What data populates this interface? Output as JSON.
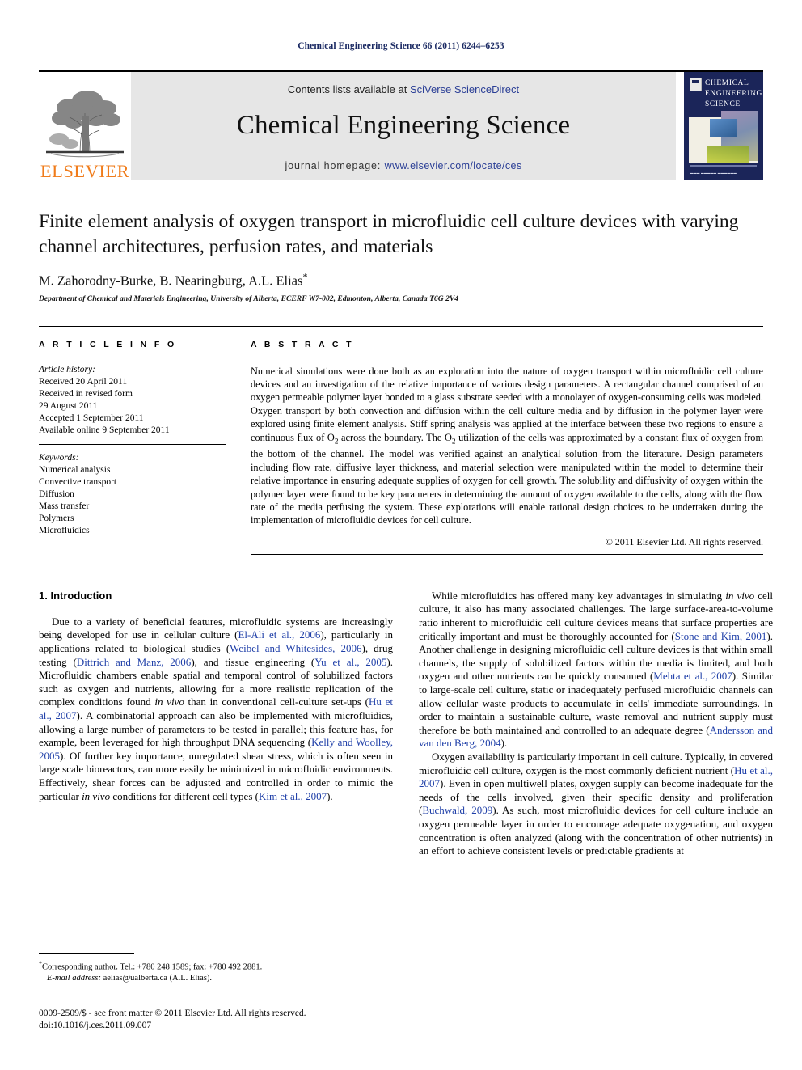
{
  "running_head": "Chemical Engineering Science 66 (2011) 6244–6253",
  "masthead": {
    "publisher_wordmark": "ELSEVIER",
    "contents_prefix": "Contents lists available at ",
    "sciencedirect_link": "SciVerse ScienceDirect",
    "journal_title": "Chemical Engineering Science",
    "homepage_prefix": "journal homepage: ",
    "homepage_link": "www.elsevier.com/locate/ces",
    "cover_title": "CHEMICAL ENGINEERING SCIENCE"
  },
  "article": {
    "title": "Finite element analysis of oxygen transport in microfluidic cell culture devices with varying channel architectures, perfusion rates, and materials",
    "authors": "M. Zahorodny-Burke, B. Nearingburg, A.L. Elias",
    "corresponding_marker": "*",
    "affiliation": "Department of Chemical and Materials Engineering, University of Alberta, ECERF W7-002, Edmonton, Alberta, Canada T6G 2V4"
  },
  "info": {
    "heading": "A R T I C L E   I N F O",
    "history_label": "Article history:",
    "history": [
      "Received 20 April 2011",
      "Received in revised form",
      "29 August 2011",
      "Accepted 1 September 2011",
      "Available online 9 September 2011"
    ],
    "keywords_label": "Keywords:",
    "keywords": [
      "Numerical analysis",
      "Convective transport",
      "Diffusion",
      "Mass transfer",
      "Polymers",
      "Microfluidics"
    ]
  },
  "abstract": {
    "heading": "A B S T R A C T",
    "part1": "Numerical simulations were done both as an exploration into the nature of oxygen transport within microfluidic cell culture devices and an investigation of the relative importance of various design parameters. A rectangular channel comprised of an oxygen permeable polymer layer bonded to a glass substrate seeded with a monolayer of oxygen-consuming cells was modeled. Oxygen transport by both convection and diffusion within the cell culture media and by diffusion in the polymer layer were explored using finite element analysis. Stiff spring analysis was applied at the interface between these two regions to ensure a continuous flux of O",
    "sub1": "2",
    "part2": " across the boundary. The O",
    "sub2": "2",
    "part3": " utilization of the cells was approximated by a constant flux of oxygen from the bottom of the channel. The model was verified against an analytical solution from the literature. Design parameters including flow rate, diffusive layer thickness, and material selection were manipulated within the model to determine their relative importance in ensuring adequate supplies of oxygen for cell growth. The solubility and diffusivity of oxygen within the polymer layer were found to be key parameters in determining the amount of oxygen available to the cells, along with the flow rate of the media perfusing the system. These explorations will enable rational design choices to be undertaken during the implementation of microfluidic devices for cell culture.",
    "copyright": "© 2011 Elsevier Ltd. All rights reserved."
  },
  "introduction": {
    "heading": "1. Introduction",
    "left_p1_a": "Due to a variety of beneficial features, microfluidic systems are increasingly being developed for use in cellular culture (",
    "cite_elali": "El-Ali et al., 2006",
    "left_p1_b": "), particularly in applications related to biological studies (",
    "cite_weibel": "Weibel and Whitesides, 2006",
    "left_p1_c": "), drug testing (",
    "cite_dittrich": "Dittrich and Manz, 2006",
    "left_p1_d": "), and tissue engineering (",
    "cite_yu": "Yu et al., 2005",
    "left_p1_e": "). Microfluidic chambers enable spatial and temporal control of solubilized factors such as oxygen and nutrients, allowing for a more realistic replication of the complex conditions found ",
    "left_p1_italic1": "in vivo",
    "left_p1_f": " than in conventional cell-culture set-ups (",
    "cite_hu1": "Hu et al., 2007",
    "left_p1_g": "). A combinatorial approach can also be implemented with microfluidics, allowing a large number of parameters to be tested in parallel; this feature has, for example, been leveraged for high throughput DNA sequencing (",
    "cite_kelly": "Kelly and Woolley, 2005",
    "left_p1_h": "). Of further key importance, unregulated shear stress, which is often seen in large scale bioreactors, can more easily be minimized in microfluidic environments. Effectively, shear forces can be adjusted and controlled in order to mimic the particular ",
    "left_p1_italic2": "in vivo",
    "left_p1_i": " conditions for different cell types (",
    "cite_kim": "Kim et al., 2007",
    "left_p1_j": ").",
    "right_p1_a": "While microfluidics has offered many key advantages in simulating ",
    "right_p1_italic1": "in vivo",
    "right_p1_b": " cell culture, it also has many associated challenges. The large surface-area-to-volume ratio inherent to microfluidic cell culture devices means that surface properties are critically important and must be thoroughly accounted for (",
    "cite_stone": "Stone and Kim, 2001",
    "right_p1_c": "). Another challenge in designing microfluidic cell culture devices is that within small channels, the supply of solubilized factors within the media is limited, and both oxygen and other nutrients can be quickly consumed (",
    "cite_mehta": "Mehta et al., 2007",
    "right_p1_d": "). Similar to large-scale cell culture, static or inadequately perfused microfluidic channels can allow cellular waste products to accumulate in cells' immediate surroundings. In order to maintain a sustainable culture, waste removal and nutrient supply must therefore be both maintained and controlled to an adequate degree (",
    "cite_andersson": "Andersson and van den Berg, 2004",
    "right_p1_e": ").",
    "right_p2_a": "Oxygen availability is particularly important in cell culture. Typically, in covered microfluidic cell culture, oxygen is the most commonly deficient nutrient (",
    "cite_hu2": "Hu et al., 2007",
    "right_p2_b": "). Even in open multiwell plates, oxygen supply can become inadequate for the needs of the cells involved, given their specific density and proliferation (",
    "cite_buchwald": "Buchwald, 2009",
    "right_p2_c": "). As such, most microfluidic devices for cell culture include an oxygen permeable layer in order to encourage adequate oxygenation, and oxygen concentration is often analyzed (along with the concentration of other nutrients) in an effort to achieve consistent levels or predictable gradients at"
  },
  "footnote": {
    "marker": "*",
    "line1": "Corresponding author. Tel.: +780 248 1589; fax: +780 492 2881.",
    "email_label": "E-mail address:",
    "email": " aelias@ualberta.ca (A.L. Elias)."
  },
  "imprint": {
    "line1": "0009-2509/$ - see front matter © 2011 Elsevier Ltd. All rights reserved.",
    "line2": "doi:10.1016/j.ces.2011.09.007"
  },
  "colors": {
    "link_blue": "#2b3f96",
    "cite_blue": "#1f3fa8",
    "elsevier_orange": "#f07c1b",
    "cover_navy": "#1b2559",
    "banner_gray": "#e6e6e6"
  }
}
